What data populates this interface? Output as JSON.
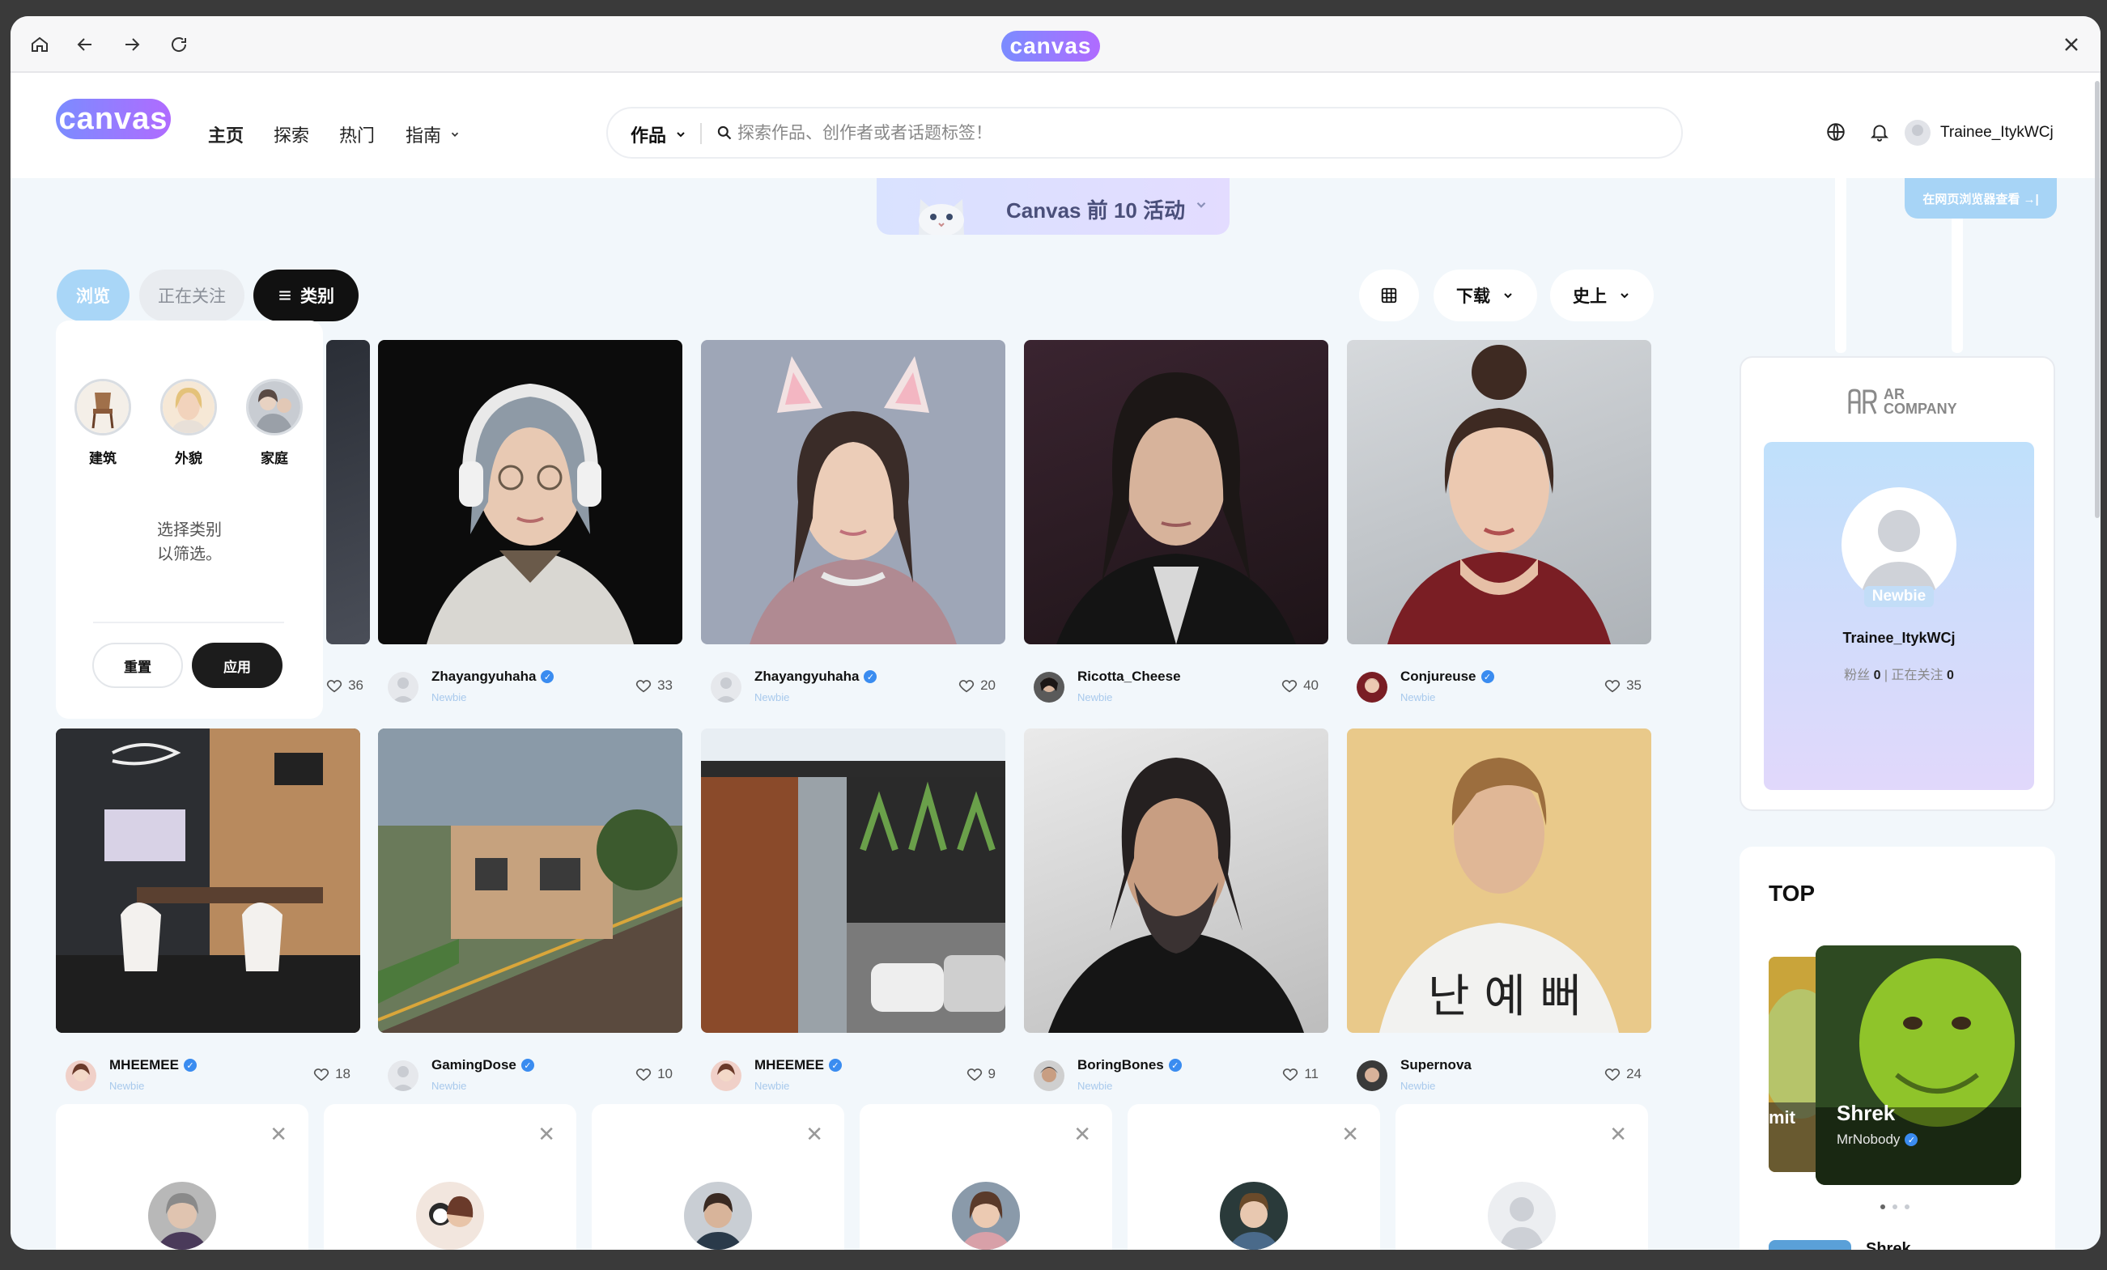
{
  "browser": {
    "logo": "canvas"
  },
  "header": {
    "logo": "canvas",
    "nav": {
      "home": "主页",
      "explore": "探索",
      "hot": "热门",
      "guide": "指南"
    },
    "search": {
      "scope": "作品",
      "placeholder": "探索作品、创作者或者话题标签！"
    },
    "username": "Trainee_ItykWCj"
  },
  "banner": {
    "title": "Canvas 前 10 活动",
    "view_in_browser": "在网页浏览器查看 →|"
  },
  "filters": {
    "browse": "浏览",
    "following": "正在关注",
    "category": "类别",
    "download": "下载",
    "history": "史上"
  },
  "category_popup": {
    "items": [
      {
        "label": "建筑"
      },
      {
        "label": "外貌"
      },
      {
        "label": "家庭"
      }
    ],
    "hint_line1": "选择类别",
    "hint_line2": "以筛选。",
    "reset": "重置",
    "apply": "应用"
  },
  "cards_row1": [
    {
      "likes": "36"
    },
    {
      "name": "Zhayangyuhaha",
      "badge": "Newbie",
      "likes": "33"
    },
    {
      "name": "Zhayangyuhaha",
      "badge": "Newbie",
      "likes": "20"
    },
    {
      "name": "Ricotta_Cheese",
      "badge": "Newbie",
      "likes": "40"
    },
    {
      "name": "Conjureuse",
      "badge": "Newbie",
      "likes": "35"
    }
  ],
  "cards_row2": [
    {
      "name": "MHEEMEE",
      "badge": "Newbie",
      "likes": "18"
    },
    {
      "name": "GamingDose",
      "badge": "Newbie",
      "likes": "10"
    },
    {
      "name": "MHEEMEE",
      "badge": "Newbie",
      "likes": "9"
    },
    {
      "name": "BoringBones",
      "badge": "Newbie",
      "likes": "11"
    },
    {
      "name": "Supernova",
      "badge": "Newbie",
      "likes": "24"
    }
  ],
  "profile": {
    "company_line1": "AR",
    "company_line2": "COMPANY",
    "badge": "Newbie",
    "username": "Trainee_ItykWCj",
    "fans_label": "粉丝",
    "fans": "0",
    "following_label": "正在关注",
    "following": "0"
  },
  "top": {
    "title": "TOP",
    "slide_prev_fragment": "mit",
    "slide_title": "Shrek",
    "slide_author": "MrNobody",
    "list_first": "Shrek"
  },
  "colors": {
    "accent": "#a9d6f7",
    "brand_gradient_start": "#7b8cff",
    "brand_gradient_end": "#b06bff"
  }
}
